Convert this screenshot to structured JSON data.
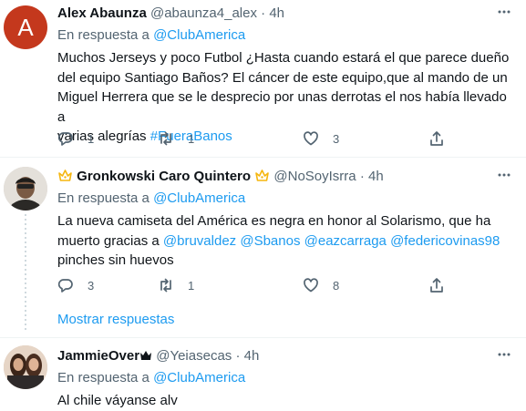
{
  "tweets": [
    {
      "name": "Alex Abaunza",
      "handle": "@abaunza4_alex",
      "separator": "·",
      "time": "4h",
      "reply_prefix": "En respuesta a",
      "reply_to": "@ClubAmerica",
      "avatar_letter": "A",
      "avatar_color": "#c4381d",
      "text_lines": [
        "Muchos Jerseys y poco Futbol ¿Hasta cuando estará el que parece dueño",
        "del equipo Santiago Baños? El cáncer de este equipo,que al mando de un",
        "Miguel Herrera que se le desprecio por unas derrotas el nos había llevado a",
        "varias alegrías "
      ],
      "hashtag": "#FueraBanos",
      "replies": "1",
      "retweets": "1",
      "likes": "3"
    },
    {
      "name": "Gronkowski Caro Quintero",
      "handle": "@NoSoyIsrra",
      "separator": "·",
      "time": "4h",
      "reply_prefix": "En respuesta a",
      "reply_to": "@ClubAmerica",
      "text_line1": "La nueva camiseta del América es negra en honor al Solarismo, que ha",
      "text_line2_prefix": "muerto gracias a ",
      "mentions": [
        "@bruvaldez",
        "@Sbanos",
        "@eazcarraga",
        "@federicovinas98"
      ],
      "text_line3": "pinches sin huevos",
      "replies": "3",
      "retweets": "1",
      "likes": "8"
    },
    {
      "name": "JammieOver",
      "handle": "@Yeiasecas",
      "separator": "·",
      "time": "4h",
      "reply_prefix": "En respuesta a",
      "reply_to": "@ClubAmerica",
      "text": "Al chile váyanse alv"
    }
  ],
  "show_replies_label": "Mostrar respuestas",
  "colors": {
    "accent": "#1d9bf0",
    "muted": "#536471",
    "crown": "#f5b60f"
  },
  "icons": [
    "reply-icon",
    "retweet-icon",
    "like-icon",
    "share-icon",
    "more-icon",
    "crown-icon"
  ]
}
